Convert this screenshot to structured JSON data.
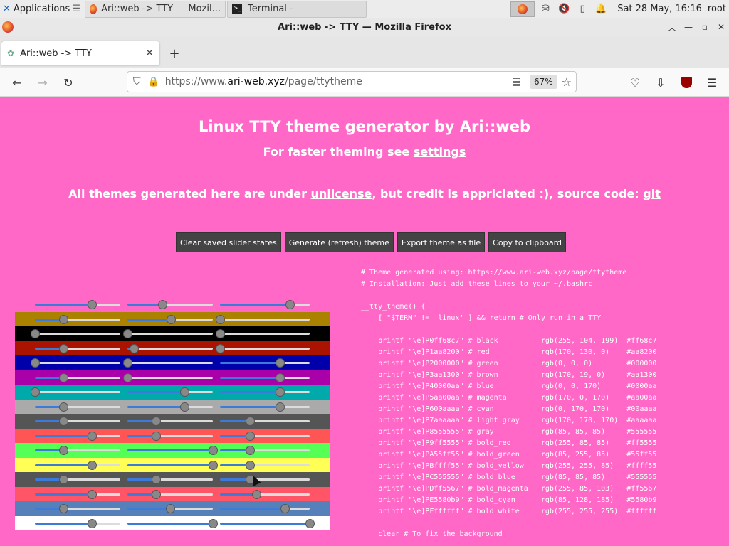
{
  "taskbar": {
    "apps_label": "Applications",
    "apps_suffix": "☰",
    "tasks": [
      {
        "label": "Ari::web -> TTY — Mozil..."
      },
      {
        "label": "Terminal -"
      }
    ],
    "clock": "Sat 28 May, 16:16",
    "user": "root"
  },
  "window": {
    "title": "Ari::web -> TTY — Mozilla Firefox"
  },
  "tab": {
    "label": "Ari::web -> TTY"
  },
  "navbar": {
    "url_prefix": "https://www.",
    "url_domain": "ari-web.xyz",
    "url_path": "/page/ttytheme",
    "zoom": "67%"
  },
  "page": {
    "title": "Linux TTY theme generator by Ari::web",
    "subtitle_text": "For faster theming see ",
    "subtitle_link": "settings",
    "license_pre": "All themes generated here are under ",
    "license_link": "unlicense",
    "license_mid": ", but credit is appriciated :), source code: ",
    "license_git": "git",
    "buttons": [
      "Clear saved slider states",
      "Generate (refresh) theme",
      "Export theme as file",
      "Copy to clipboard"
    ]
  },
  "slider_rows": [
    {
      "bg": "#ff68c7",
      "r": 170,
      "g": 104,
      "b": 199
    },
    {
      "bg": "#aa8200",
      "r": 85,
      "g": 130,
      "b": 0
    },
    {
      "bg": "#000000",
      "r": 0,
      "g": 0,
      "b": 0
    },
    {
      "bg": "#aa1300",
      "r": 85,
      "g": 19,
      "b": 0
    },
    {
      "bg": "#0000aa",
      "r": 0,
      "g": 0,
      "b": 170
    },
    {
      "bg": "#aa00aa",
      "r": 85,
      "g": 0,
      "b": 170
    },
    {
      "bg": "#00aaaa",
      "r": 0,
      "g": 170,
      "b": 170
    },
    {
      "bg": "#aaaaaa",
      "r": 85,
      "g": 170,
      "b": 170
    },
    {
      "bg": "#555555",
      "r": 85,
      "g": 85,
      "b": 85
    },
    {
      "bg": "#ff5555",
      "r": 170,
      "g": 85,
      "b": 85
    },
    {
      "bg": "#55ff55",
      "r": 85,
      "g": 255,
      "b": 85
    },
    {
      "bg": "#ffff55",
      "r": 170,
      "g": 255,
      "b": 85
    },
    {
      "bg": "#555555",
      "r": 85,
      "g": 85,
      "b": 85
    },
    {
      "bg": "#ff5567",
      "r": 170,
      "g": 85,
      "b": 103
    },
    {
      "bg": "#5580b9",
      "r": 85,
      "g": 128,
      "b": 185
    },
    {
      "bg": "#ffffff",
      "r": 170,
      "g": 255,
      "b": 255
    }
  ],
  "code_lines": [
    "# Theme generated using: https://www.ari-web.xyz/page/ttytheme",
    "# Installation: Just add these lines to your ~/.bashrc",
    "",
    "__tty_theme() {",
    "    [ \"$TERM\" != 'linux' ] && return # Only run in a TTY",
    "",
    "    printf \"\\e]P0ff68c7\" # black          rgb(255, 104, 199)  #ff68c7",
    "    printf \"\\e]P1aa8200\" # red            rgb(170, 130, 0)    #aa8200",
    "    printf \"\\e]P2000000\" # green          rgb(0, 0, 0)        #000000",
    "    printf \"\\e]P3aa1300\" # brown          rgb(170, 19, 0)     #aa1300",
    "    printf \"\\e]P40000aa\" # blue           rgb(0, 0, 170)      #0000aa",
    "    printf \"\\e]P5aa00aa\" # magenta        rgb(170, 0, 170)    #aa00aa",
    "    printf \"\\e]P600aaaa\" # cyan           rgb(0, 170, 170)    #00aaaa",
    "    printf \"\\e]P7aaaaaa\" # light_gray     rgb(170, 170, 170)  #aaaaaa",
    "    printf \"\\e]P8555555\" # gray           rgb(85, 85, 85)     #555555",
    "    printf \"\\e]P9ff5555\" # bold_red       rgb(255, 85, 85)    #ff5555",
    "    printf \"\\e]PA55ff55\" # bold_green     rgb(85, 255, 85)    #55ff55",
    "    printf \"\\e]PBffff55\" # bold_yellow    rgb(255, 255, 85)   #ffff55",
    "    printf \"\\e]PC555555\" # bold_blue      rgb(85, 85, 85)     #555555",
    "    printf \"\\e]PDff5567\" # bold_magenta   rgb(255, 85, 103)   #ff5567",
    "    printf \"\\e]PE5580b9\" # bold_cyan      rgb(85, 128, 185)   #5580b9",
    "    printf \"\\e]PFffffff\" # bold_white     rgb(255, 255, 255)  #ffffff",
    "",
    "    clear # To fix the background"
  ]
}
